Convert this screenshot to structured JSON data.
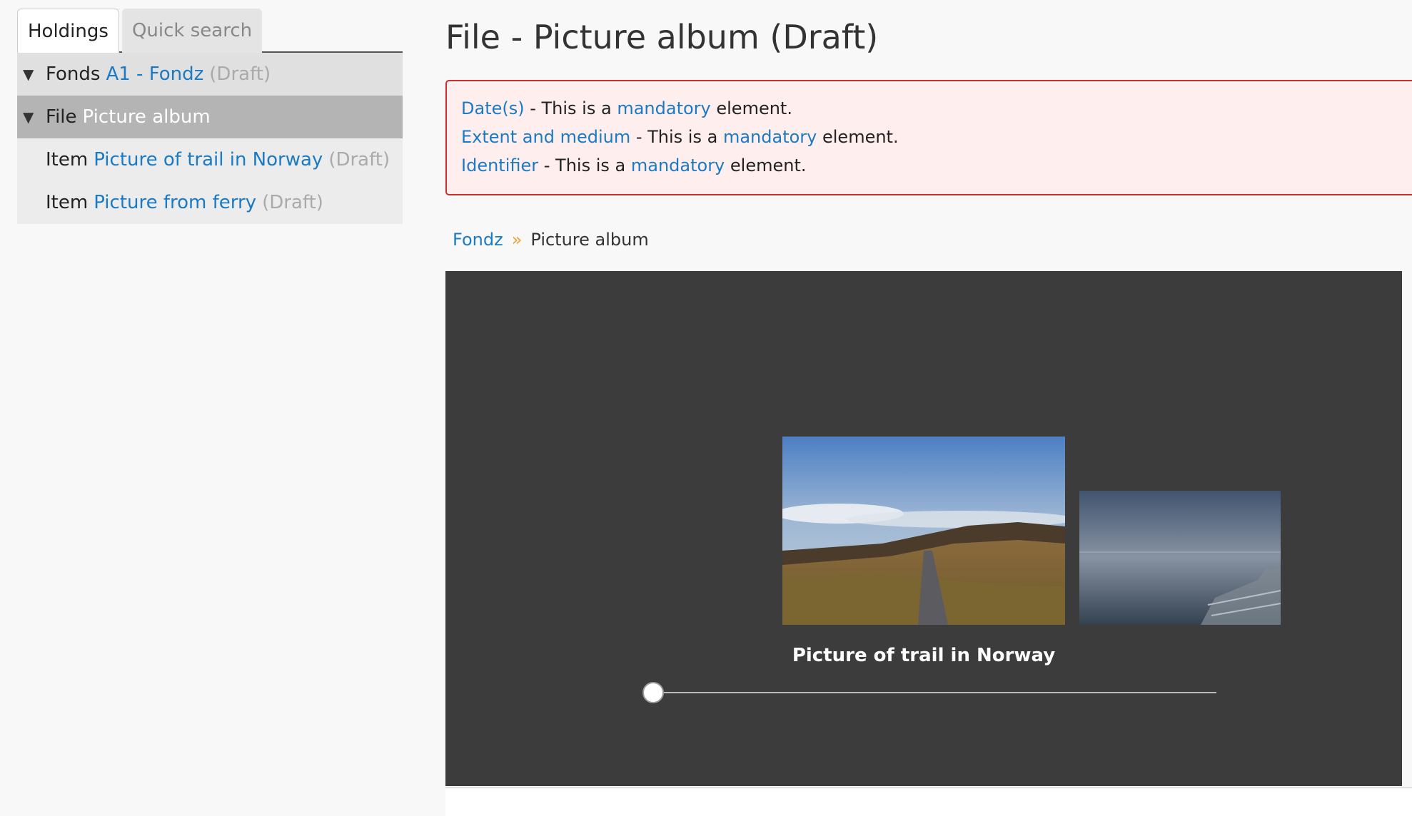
{
  "tabs": {
    "holdings": "Holdings",
    "quick_search": "Quick search"
  },
  "tree": {
    "fonds": {
      "level": "Fonds",
      "title": "A1 - Fondz",
      "status": "(Draft)"
    },
    "file": {
      "level": "File",
      "title": "Picture album"
    },
    "items": [
      {
        "level": "Item",
        "title": "Picture of trail in Norway",
        "status": "(Draft)"
      },
      {
        "level": "Item",
        "title": "Picture from ferry",
        "status": "(Draft)"
      }
    ]
  },
  "page": {
    "title": "File - Picture album (Draft)"
  },
  "errors": [
    {
      "field": "Date(s)",
      "text1": " - This is a ",
      "link": "mandatory",
      "text2": " element."
    },
    {
      "field": "Extent and medium",
      "text1": " - This is a ",
      "link": "mandatory",
      "text2": " element."
    },
    {
      "field": "Identifier",
      "text1": " - This is a ",
      "link": "mandatory",
      "text2": " element."
    }
  ],
  "breadcrumb": {
    "parent": "Fondz",
    "separator_icon": "double-chevron-right-icon",
    "current": "Picture album"
  },
  "viewer": {
    "caption": "Picture of trail in Norway",
    "slider_position": 0
  },
  "colors": {
    "link": "#1b7ac4",
    "error_border": "#c9302c",
    "error_bg": "#ffeeee",
    "viewer_bg": "#3c3c3c"
  }
}
